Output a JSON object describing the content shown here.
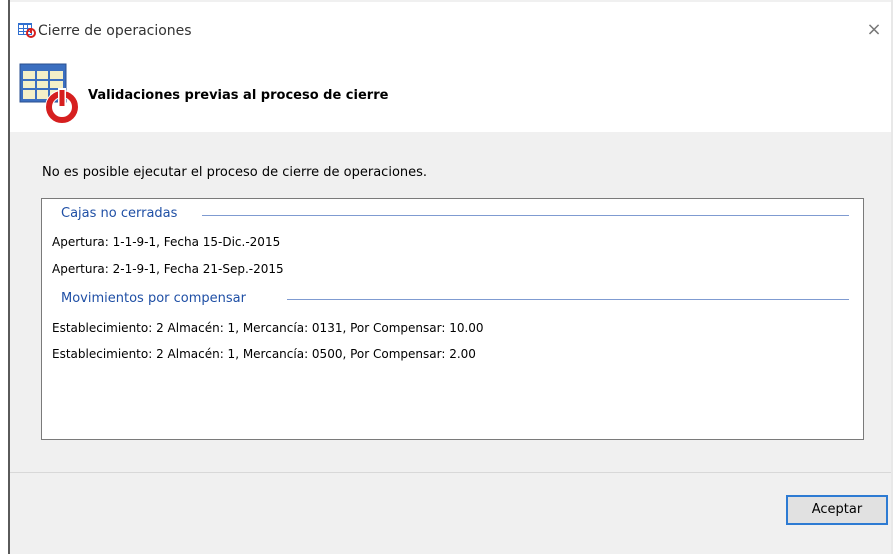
{
  "window": {
    "title": "Cierre de operaciones",
    "close_glyph": "×",
    "title_icon": "calendar-grid-icon"
  },
  "header": {
    "title": "Validaciones previas al proceso de cierre",
    "icon": "calendar-power-icon"
  },
  "message": "No es posible ejecutar el proceso de cierre de operaciones.",
  "groups": [
    {
      "title": "Cajas no cerradas",
      "items": [
        "Apertura: 1-1-9-1, Fecha 15-Dic.-2015",
        "Apertura: 2-1-9-1, Fecha 21-Sep.-2015"
      ]
    },
    {
      "title": "Movimientos por compensar",
      "items": [
        "Establecimiento: 2 Almacén: 1, Mercancía: 0131, Por Compensar: 10.00",
        "Establecimiento: 2 Almacén: 1, Mercancía: 0500, Por Compensar: 2.00"
      ]
    }
  ],
  "buttons": {
    "ok": "Aceptar"
  },
  "colors": {
    "group_header": "#1f4fa5",
    "accent_border": "#2d7bd3",
    "dialog_bg": "#f0f0f0"
  }
}
